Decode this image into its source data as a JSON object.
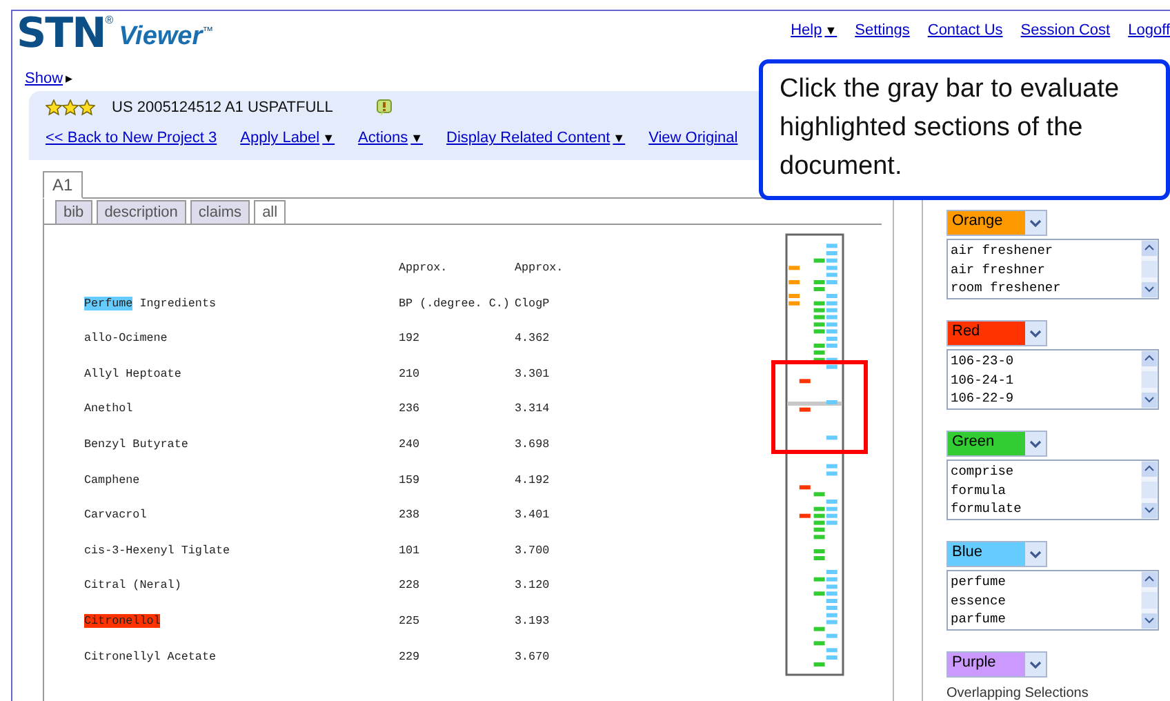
{
  "logo": {
    "name": "STN",
    "registered": "®",
    "product": "Viewer",
    "trademark": "™"
  },
  "top_links": [
    {
      "label": "Help",
      "caret": "▼"
    },
    {
      "label": "Settings"
    },
    {
      "label": "Contact Us"
    },
    {
      "label": "Session Cost"
    },
    {
      "label": "Logoff"
    }
  ],
  "show_link": {
    "label": "Show",
    "arrow": "▸"
  },
  "record": {
    "stars": 3,
    "title": "US 2005124512 A1 USPATFULL"
  },
  "record_links": [
    {
      "label": "<< Back to New Project 3"
    },
    {
      "label": "Apply Label",
      "caret": "▼"
    },
    {
      "label": "Actions",
      "caret": "▼"
    },
    {
      "label": "Display Related Content",
      "caret": "▼"
    },
    {
      "label": "View Original"
    }
  ],
  "callout": {
    "text": "Click the gray bar to evaluate highlighted sections of the document."
  },
  "doc_tabs": [
    {
      "label": "A1",
      "selected": true
    }
  ],
  "section_tabs": [
    {
      "label": "bib",
      "selected": false
    },
    {
      "label": "description",
      "selected": false
    },
    {
      "label": "claims",
      "selected": false
    },
    {
      "label": "all",
      "selected": true
    }
  ],
  "table": {
    "header_top": [
      "Approx.",
      "Approx."
    ],
    "rows": [
      {
        "name": [
          {
            "text": "Perfume",
            "color": "#66ccff"
          },
          {
            "text": " Ingredients"
          }
        ],
        "bp": "BP (.degree. C.)",
        "clogp": "ClogP"
      },
      {
        "name": [
          {
            "text": "allo-Ocimene"
          }
        ],
        "bp": "192",
        "clogp": "4.362"
      },
      {
        "name": [
          {
            "text": "Allyl Heptoate"
          }
        ],
        "bp": "210",
        "clogp": "3.301"
      },
      {
        "name": [
          {
            "text": "Anethol"
          }
        ],
        "bp": "236",
        "clogp": "3.314"
      },
      {
        "name": [
          {
            "text": "Benzyl Butyrate"
          }
        ],
        "bp": "240",
        "clogp": "3.698"
      },
      {
        "name": [
          {
            "text": "Camphene"
          }
        ],
        "bp": "159",
        "clogp": "4.192"
      },
      {
        "name": [
          {
            "text": "Carvacrol"
          }
        ],
        "bp": "238",
        "clogp": "3.401"
      },
      {
        "name": [
          {
            "text": "cis-3-Hexenyl Tiglate"
          }
        ],
        "bp": "101",
        "clogp": "3.700"
      },
      {
        "name": [
          {
            "text": "Citral (Neral)"
          }
        ],
        "bp": "228",
        "clogp": "3.120"
      },
      {
        "name": [
          {
            "text": "Citronellol",
            "color": "#ff3300"
          }
        ],
        "bp": "225",
        "clogp": "3.193"
      },
      {
        "name": [
          {
            "text": "Citronellyl Acetate"
          }
        ],
        "bp": "229",
        "clogp": "3.670"
      }
    ]
  },
  "term_groups": [
    {
      "label": "Orange",
      "color": "#ff9900",
      "terms": [
        "air freshener",
        "air freshner",
        "room freshener"
      ]
    },
    {
      "label": "Red",
      "color": "#ff3300",
      "terms": [
        "106-23-0",
        "106-24-1",
        "106-22-9"
      ]
    },
    {
      "label": "Green",
      "color": "#33cc33",
      "terms": [
        "comprise",
        "formula",
        "formulate"
      ]
    },
    {
      "label": "Blue",
      "color": "#66ccff",
      "terms": [
        "perfume",
        "essence",
        "parfume"
      ]
    },
    {
      "label": "Purple",
      "color": "#cc99ff"
    }
  ],
  "overlap_label": "Overlapping Selections"
}
